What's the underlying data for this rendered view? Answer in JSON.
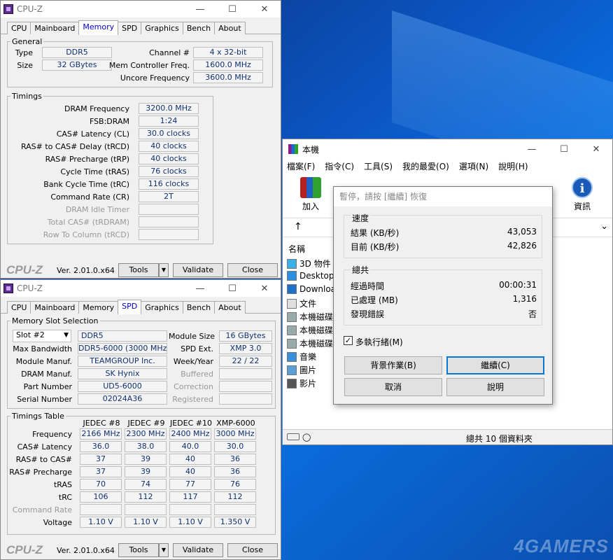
{
  "desktop": {
    "watermark": "4GAMERS"
  },
  "cpuz_top": {
    "title": "CPU-Z",
    "tabs": [
      "CPU",
      "Mainboard",
      "Memory",
      "SPD",
      "Graphics",
      "Bench",
      "About"
    ],
    "active_tab": "Memory",
    "general_legend": "General",
    "type_label": "Type",
    "type_value": "DDR5",
    "size_label": "Size",
    "size_value": "32 GBytes",
    "channel_label": "Channel #",
    "channel_value": "4 x 32-bit",
    "memctrl_label": "Mem Controller Freq.",
    "memctrl_value": "1600.0 MHz",
    "uncore_label": "Uncore Frequency",
    "uncore_value": "3600.0 MHz",
    "timings_legend": "Timings",
    "timings": [
      {
        "label": "DRAM Frequency",
        "value": "3200.0 MHz"
      },
      {
        "label": "FSB:DRAM",
        "value": "1:24"
      },
      {
        "label": "CAS# Latency (CL)",
        "value": "30.0 clocks"
      },
      {
        "label": "RAS# to CAS# Delay (tRCD)",
        "value": "40 clocks"
      },
      {
        "label": "RAS# Precharge (tRP)",
        "value": "40 clocks"
      },
      {
        "label": "Cycle Time (tRAS)",
        "value": "76 clocks"
      },
      {
        "label": "Bank Cycle Time (tRC)",
        "value": "116 clocks"
      },
      {
        "label": "Command Rate (CR)",
        "value": "2T"
      },
      {
        "label": "DRAM Idle Timer",
        "value": ""
      },
      {
        "label": "Total CAS# (tRDRAM)",
        "value": ""
      },
      {
        "label": "Row To Column (tRCD)",
        "value": ""
      }
    ],
    "footer": {
      "brand": "CPU-Z",
      "version": "Ver. 2.01.0.x64",
      "tools": "Tools",
      "validate": "Validate",
      "close": "Close"
    }
  },
  "cpuz_bottom": {
    "title": "CPU-Z",
    "tabs": [
      "CPU",
      "Mainboard",
      "Memory",
      "SPD",
      "Graphics",
      "Bench",
      "About"
    ],
    "active_tab": "SPD",
    "slot_legend": "Memory Slot Selection",
    "slot_value": "Slot #2",
    "slot_type": "DDR5",
    "left_rows": [
      {
        "label": "Max Bandwidth",
        "value": "DDR5-6000 (3000 MHz)"
      },
      {
        "label": "Module Manuf.",
        "value": "TEAMGROUP Inc."
      },
      {
        "label": "DRAM Manuf.",
        "value": "SK Hynix"
      },
      {
        "label": "Part Number",
        "value": "UD5-6000"
      },
      {
        "label": "Serial Number",
        "value": "02024A36"
      }
    ],
    "right_rows": [
      {
        "label": "Module Size",
        "value": "16 GBytes",
        "grey": false
      },
      {
        "label": "SPD Ext.",
        "value": "XMP 3.0",
        "grey": false
      },
      {
        "label": "Week/Year",
        "value": "22 / 22",
        "grey": false
      },
      {
        "label": "Buffered",
        "value": "",
        "grey": true
      },
      {
        "label": "Correction",
        "value": "",
        "grey": true
      },
      {
        "label": "Registered",
        "value": "",
        "grey": true
      }
    ],
    "timings_legend": "Timings Table",
    "columns": [
      "JEDEC #8",
      "JEDEC #9",
      "JEDEC #10",
      "XMP-6000"
    ],
    "rows": [
      {
        "label": "Frequency",
        "values": [
          "2166 MHz",
          "2300 MHz",
          "2400 MHz",
          "3000 MHz"
        ],
        "grey": false
      },
      {
        "label": "CAS# Latency",
        "values": [
          "36.0",
          "38.0",
          "40.0",
          "30.0"
        ],
        "grey": false
      },
      {
        "label": "RAS# to CAS#",
        "values": [
          "37",
          "39",
          "40",
          "36"
        ],
        "grey": false
      },
      {
        "label": "RAS# Precharge",
        "values": [
          "37",
          "39",
          "40",
          "36"
        ],
        "grey": false
      },
      {
        "label": "tRAS",
        "values": [
          "70",
          "74",
          "77",
          "76"
        ],
        "grey": false
      },
      {
        "label": "tRC",
        "values": [
          "106",
          "112",
          "117",
          "112"
        ],
        "grey": false
      },
      {
        "label": "Command Rate",
        "values": [
          "",
          "",
          "",
          ""
        ],
        "grey": true
      },
      {
        "label": "Voltage",
        "values": [
          "1.10 V",
          "1.10 V",
          "1.10 V",
          "1.350 V"
        ],
        "grey": false
      }
    ],
    "footer": {
      "brand": "CPU-Z",
      "version": "Ver. 2.01.0.x64",
      "tools": "Tools",
      "validate": "Validate",
      "close": "Close"
    }
  },
  "explorer": {
    "title": "本機",
    "menu": [
      "檔案(F)",
      "指令(C)",
      "工具(S)",
      "我的最愛(O)",
      "選項(N)",
      "說明(H)"
    ],
    "toolbar_add": "加入",
    "toolbar_info": "資訊",
    "column_name": "名稱",
    "items": [
      "3D 物件",
      "Desktop",
      "Downloads",
      "文件",
      "本機磁碟",
      "本機磁碟",
      "本機磁碟",
      "音樂",
      "圖片",
      "影片"
    ],
    "status_total": "總共 10 個資料夾"
  },
  "dialog": {
    "title": "暫停，請按 [繼續] 恢復",
    "speed_header": "速度",
    "result_label": "結果 (KB/秒)",
    "result_value": "43,053",
    "current_label": "目前 (KB/秒)",
    "current_value": "42,826",
    "total_header": "總共",
    "elapsed_label": "經過時間",
    "elapsed_value": "00:00:31",
    "processed_label": "已處理 (MB)",
    "processed_value": "1,316",
    "errors_label": "發現錯誤",
    "errors_value": "否",
    "multithread_label": "多執行緒(M)",
    "multithread_checked": true,
    "background_btn": "背景作業(B)",
    "continue_btn": "繼續(C)",
    "cancel_btn": "取消",
    "help_btn": "說明"
  }
}
